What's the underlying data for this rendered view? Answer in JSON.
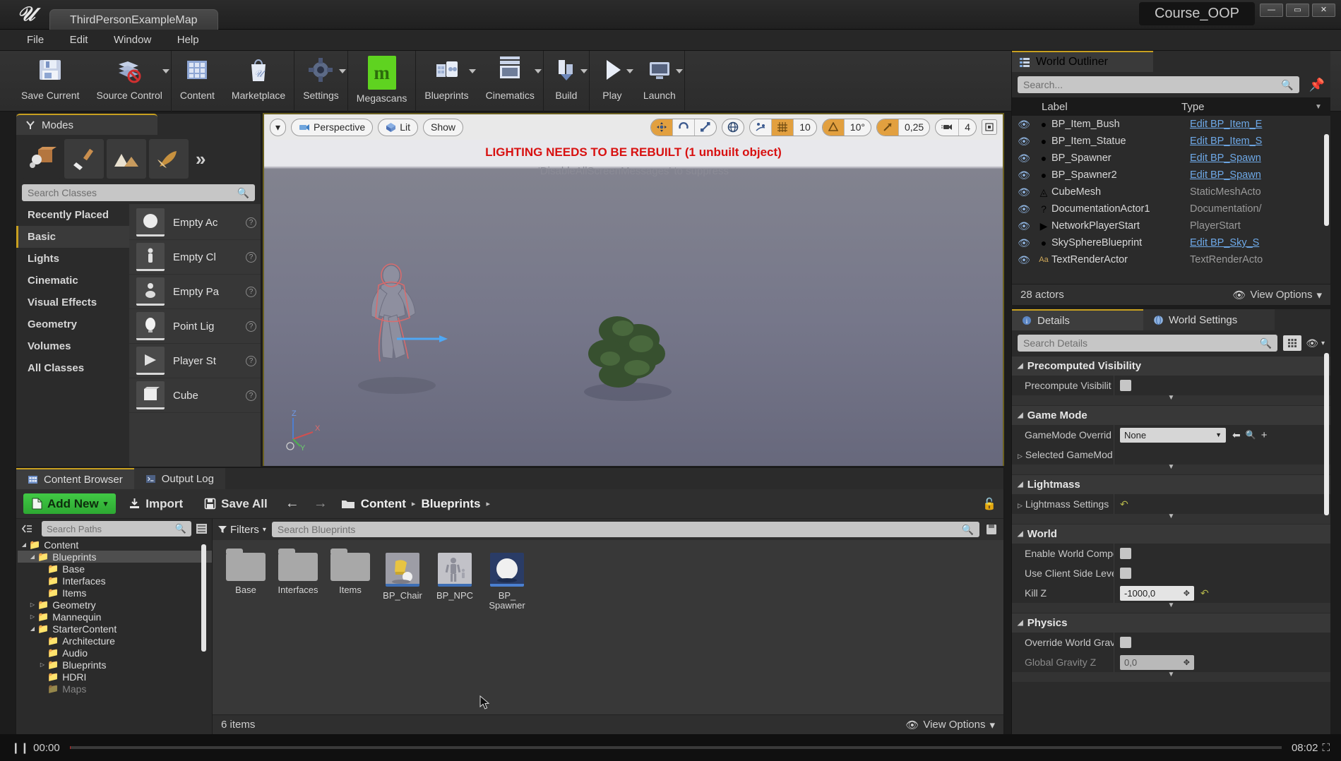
{
  "titlebar": {
    "map_tab": "ThirdPersonExampleMap",
    "project_badge": "Course_OOP",
    "project_icon": "blue-cube-icon",
    "minimize": "—",
    "maximize": "▭",
    "close": "✕"
  },
  "menubar": {
    "items": [
      "File",
      "Edit",
      "Window",
      "Help"
    ]
  },
  "toolbar": {
    "groups": [
      {
        "items": [
          {
            "label": "Save Current",
            "icon": "floppy-disk-icon",
            "caret": false
          },
          {
            "label": "Source Control",
            "icon": "source-control-blocked-icon",
            "caret": true
          }
        ]
      },
      {
        "items": [
          {
            "label": "Content",
            "icon": "content-grid-icon",
            "caret": false
          },
          {
            "label": "Marketplace",
            "icon": "marketplace-bag-icon",
            "caret": false
          }
        ]
      },
      {
        "items": [
          {
            "label": "Settings",
            "icon": "gear-icon",
            "caret": true
          }
        ]
      },
      {
        "items": [
          {
            "label": "Megascans",
            "icon": "megascans-icon",
            "caret": false
          }
        ]
      },
      {
        "items": [
          {
            "label": "Blueprints",
            "icon": "blueprints-icon",
            "caret": true
          },
          {
            "label": "Cinematics",
            "icon": "cinematics-clapper-icon",
            "caret": true
          }
        ]
      },
      {
        "items": [
          {
            "label": "Build",
            "icon": "build-icon",
            "caret": true
          }
        ]
      },
      {
        "items": [
          {
            "label": "Play",
            "icon": "play-triangle-icon",
            "caret": true
          },
          {
            "label": "Launch",
            "icon": "launch-device-icon",
            "caret": true
          }
        ]
      }
    ]
  },
  "modes": {
    "tab_title": "Modes",
    "tab_icon": "modes-icon",
    "mode_buttons": [
      "place-mode-icon",
      "paint-mode-icon",
      "landscape-mode-icon",
      "foliage-mode-icon"
    ],
    "expand_icon": "chevron-double-right-icon",
    "search_placeholder": "Search Classes",
    "search_icon": "search-icon",
    "categories": [
      {
        "label": "Recently Placed",
        "active": false
      },
      {
        "label": "Basic",
        "active": true
      },
      {
        "label": "Lights",
        "active": false
      },
      {
        "label": "Cinematic",
        "active": false
      },
      {
        "label": "Visual Effects",
        "active": false
      },
      {
        "label": "Geometry",
        "active": false
      },
      {
        "label": "Volumes",
        "active": false
      },
      {
        "label": "All Classes",
        "active": false
      }
    ],
    "placeables": [
      {
        "label": "Empty Ac",
        "icon": "sphere-icon",
        "info": "?"
      },
      {
        "label": "Empty Cl",
        "icon": "character-icon",
        "info": "?"
      },
      {
        "label": "Empty Pa",
        "icon": "pawn-icon",
        "info": "?"
      },
      {
        "label": "Point Lig",
        "icon": "lightbulb-icon",
        "info": "?"
      },
      {
        "label": "Player St",
        "icon": "playerstart-icon",
        "info": "?"
      },
      {
        "label": "Cube",
        "icon": "cube-icon",
        "info": "?"
      }
    ]
  },
  "viewport": {
    "menu_caret": "▾",
    "perspective": "Perspective",
    "perspective_icon": "camera-icon",
    "lit": "Lit",
    "lit_icon": "lit-cube-icon",
    "show": "Show",
    "transform_icons": [
      "move-icon",
      "rotate-icon",
      "scale-icon"
    ],
    "world_icon": "globe-icon",
    "surface_snap_icon": "surface-snap-icon",
    "grid_icon": "grid-icon",
    "grid_size": "10",
    "angle_icon": "angle-snap-icon",
    "angle_size": "10°",
    "scale_icon": "scale-snap-icon",
    "scale_size": "0,25",
    "camera_icon": "camera-speed-icon",
    "camera_speed": "4",
    "maximize_icon": "maximize-viewport-icon",
    "warning": "LIGHTING NEEDS TO BE REBUILT (1 unbuilt object)",
    "warning_sub": "'DisableAllScreenMessages' to suppress",
    "axis_labels": [
      "Z",
      "Y",
      "X"
    ]
  },
  "outliner": {
    "title": "World Outliner",
    "title_icon": "outliner-icon",
    "search_placeholder": "Search...",
    "search_icon": "search-icon",
    "pin_icon": "pin-icon",
    "columns": [
      "Label",
      "Type"
    ],
    "sort_icon": "sort-descending-icon",
    "rows": [
      {
        "eye": "eye-icon",
        "icon": "blueprint-actor-icon",
        "label": "BP_Item_Bush",
        "type": "Edit BP_Item_E",
        "link": true
      },
      {
        "eye": "eye-icon",
        "icon": "blueprint-actor-icon",
        "label": "BP_Item_Statue",
        "type": "Edit BP_Item_S",
        "link": true
      },
      {
        "eye": "eye-icon",
        "icon": "blueprint-actor-icon",
        "label": "BP_Spawner",
        "type": "Edit BP_Spawn",
        "link": true
      },
      {
        "eye": "eye-icon",
        "icon": "blueprint-actor-icon",
        "label": "BP_Spawner2",
        "type": "Edit BP_Spawn",
        "link": true
      },
      {
        "eye": "eye-icon",
        "icon": "static-mesh-icon",
        "label": "CubeMesh",
        "type": "StaticMeshActo",
        "link": false
      },
      {
        "eye": "eye-icon",
        "icon": "documentation-icon",
        "label": "DocumentationActor1",
        "type": "Documentation/",
        "link": false
      },
      {
        "eye": "eye-icon",
        "icon": "playerstart-icon",
        "label": "NetworkPlayerStart",
        "type": "PlayerStart",
        "link": false
      },
      {
        "eye": "eye-icon",
        "icon": "sky-sphere-icon",
        "label": "SkySphereBlueprint",
        "type": "Edit BP_Sky_S",
        "link": true
      },
      {
        "eye": "eye-icon",
        "icon": "text-render-icon",
        "label": "TextRenderActor",
        "type": "TextRenderActo",
        "link": false
      }
    ],
    "actor_count": "28 actors",
    "view_options": "View Options",
    "view_options_icon": "eye-icon",
    "view_options_caret": "▾"
  },
  "details": {
    "tabs": [
      {
        "label": "Details",
        "icon": "details-icon",
        "active": true
      },
      {
        "label": "World Settings",
        "icon": "world-settings-icon",
        "active": false
      }
    ],
    "search_placeholder": "Search Details",
    "search_icon": "search-icon",
    "grid_icon": "grid-view-icon",
    "eye_icon": "eye-icon",
    "caret": "▾",
    "sections": [
      {
        "title": "Precomputed Visibility",
        "rows": [
          {
            "label": "Precompute Visibilit",
            "control": "checkbox",
            "value": "",
            "dim": false,
            "reset": false
          }
        ]
      },
      {
        "title": "Game Mode",
        "rows": [
          {
            "label": "GameMode Overrid",
            "control": "combo",
            "value": "None",
            "dim": false,
            "reset": false,
            "extra_icons": [
              "arrow-left-icon",
              "search-icon",
              "plus-icon"
            ]
          },
          {
            "label": "Selected GameMod",
            "control": "expand",
            "value": "",
            "dim": false,
            "reset": false
          }
        ]
      },
      {
        "title": "Lightmass",
        "rows": [
          {
            "label": "Lightmass Settings",
            "control": "expand-reset",
            "value": "",
            "dim": false,
            "reset": true
          }
        ]
      },
      {
        "title": "World",
        "rows": [
          {
            "label": "Enable World Compo",
            "control": "checkbox",
            "value": "",
            "dim": false,
            "reset": false
          },
          {
            "label": "Use Client Side Leve",
            "control": "checkbox",
            "value": "",
            "dim": false,
            "reset": false
          },
          {
            "label": "Kill Z",
            "control": "number",
            "value": "-1000,0",
            "dim": false,
            "reset": true
          }
        ]
      },
      {
        "title": "Physics",
        "rows": [
          {
            "label": "Override World Grav",
            "control": "checkbox",
            "value": "",
            "dim": false,
            "reset": false
          },
          {
            "label": "Global Gravity Z",
            "control": "number",
            "value": "0,0",
            "dim": true,
            "reset": false
          }
        ]
      }
    ]
  },
  "content_browser": {
    "tabs": [
      {
        "label": "Content Browser",
        "icon": "content-browser-icon",
        "active": true
      },
      {
        "label": "Output Log",
        "icon": "output-log-icon",
        "active": false
      }
    ],
    "add_new": "Add New",
    "add_new_icon": "new-asset-icon",
    "add_new_caret": "▾",
    "import": "Import",
    "import_icon": "import-icon",
    "save_all": "Save All",
    "save_all_icon": "floppy-disk-icon",
    "back_icon": "arrow-left-icon",
    "forward_icon": "arrow-right-icon",
    "folder_icon": "folder-open-icon",
    "breadcrumbs": [
      "Content",
      "Blueprints"
    ],
    "breadcrumb_sep": "▸",
    "lock_icon": "lock-icon",
    "path_search_placeholder": "Search Paths",
    "path_search_icon": "search-icon",
    "collapse_icon": "collapse-tree-icon",
    "list_view_icon": "list-view-icon",
    "tree": [
      {
        "label": "Content",
        "depth": 0,
        "arrow": "open",
        "selected": false
      },
      {
        "label": "Blueprints",
        "depth": 1,
        "arrow": "open",
        "selected": true
      },
      {
        "label": "Base",
        "depth": 2,
        "arrow": "none",
        "selected": false
      },
      {
        "label": "Interfaces",
        "depth": 2,
        "arrow": "none",
        "selected": false
      },
      {
        "label": "Items",
        "depth": 2,
        "arrow": "none",
        "selected": false
      },
      {
        "label": "Geometry",
        "depth": 1,
        "arrow": "closed",
        "selected": false
      },
      {
        "label": "Mannequin",
        "depth": 1,
        "arrow": "closed",
        "selected": false
      },
      {
        "label": "StarterContent",
        "depth": 1,
        "arrow": "open",
        "selected": false
      },
      {
        "label": "Architecture",
        "depth": 2,
        "arrow": "none",
        "selected": false
      },
      {
        "label": "Audio",
        "depth": 2,
        "arrow": "none",
        "selected": false
      },
      {
        "label": "Blueprints",
        "depth": 2,
        "arrow": "closed",
        "selected": false
      },
      {
        "label": "HDRI",
        "depth": 2,
        "arrow": "none",
        "selected": false
      },
      {
        "label": "Maps",
        "depth": 2,
        "arrow": "none",
        "selected": false
      }
    ],
    "filters": "Filters",
    "filters_icon": "filter-funnel-icon",
    "filters_caret": "▾",
    "asset_search_placeholder": "Search Blueprints",
    "asset_search_icon": "search-icon",
    "save_asset_icon": "save-asset-icon",
    "assets": [
      {
        "name": "Base",
        "kind": "folder"
      },
      {
        "name": "Interfaces",
        "kind": "folder"
      },
      {
        "name": "Items",
        "kind": "folder"
      },
      {
        "name": "BP_Chair",
        "kind": "blueprint-chair"
      },
      {
        "name": "BP_NPC",
        "kind": "blueprint-npc"
      },
      {
        "name": "BP_ Spawner",
        "kind": "blueprint-sphere"
      }
    ],
    "item_count": "6 items",
    "view_options": "View Options",
    "view_options_icon": "eye-icon",
    "view_options_caret": "▾"
  },
  "statusbar": {
    "pause_icon": "pause-icon",
    "current_time": "00:00",
    "total_time": "08:02",
    "fullscreen_icon": "fullscreen-icon"
  }
}
